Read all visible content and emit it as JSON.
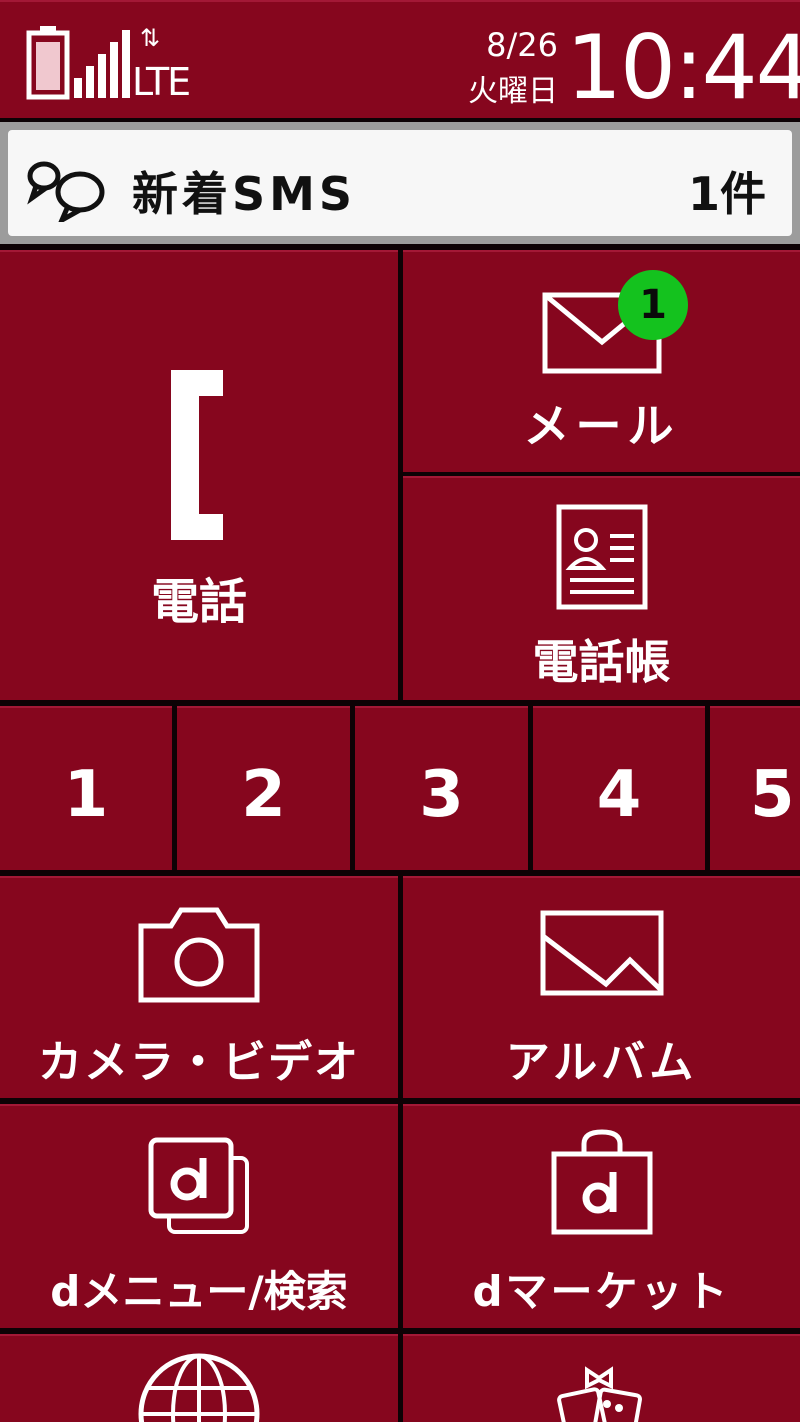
{
  "status": {
    "network": "LTE",
    "date": "8/26",
    "day": "火曜日",
    "time": "10:44"
  },
  "notification": {
    "title": "新着SMS",
    "count": "1件"
  },
  "tiles": {
    "phone": "電話",
    "mail": "メール",
    "mail_badge": "1",
    "contacts": "電話帳",
    "camera": "カメラ・ビデオ",
    "album": "アルバム",
    "dmenu": "dメニュー/検索",
    "dmarket": "dマーケット"
  },
  "speed_dial": [
    "1",
    "2",
    "3",
    "4",
    "5"
  ],
  "colors": {
    "tile_red": "#86061e",
    "badge_green": "#14c21e",
    "notification_bg": "#f7f7f7"
  }
}
